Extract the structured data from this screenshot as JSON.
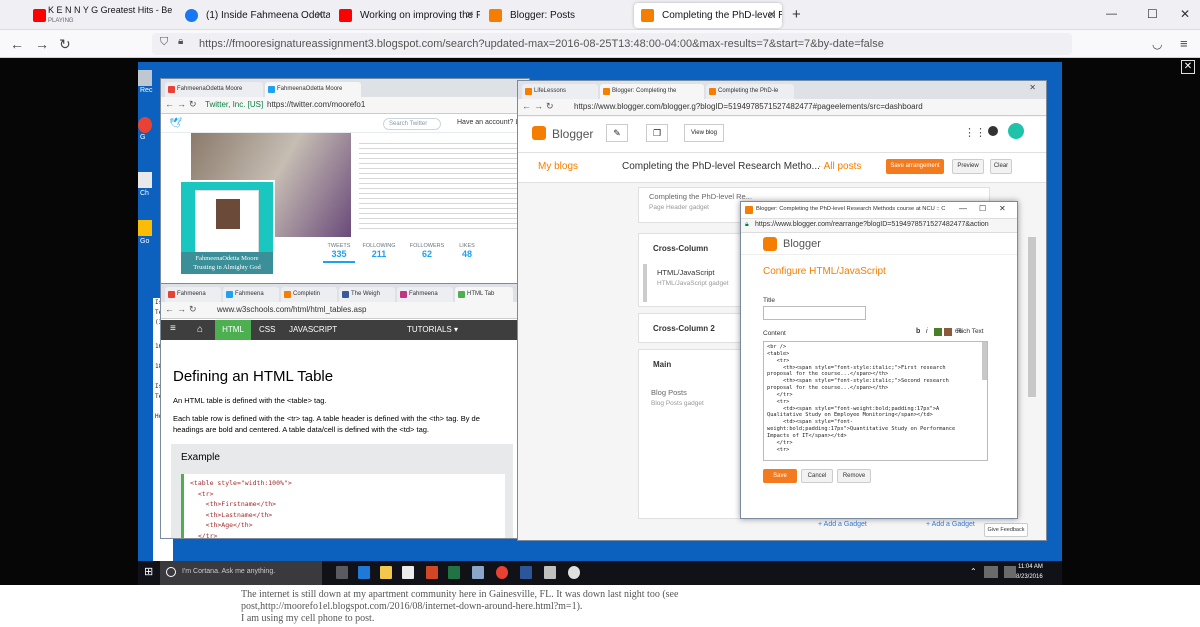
{
  "browser": {
    "tabs": [
      {
        "label": "K E N N Y G Greatest Hits - Be",
        "sublabel": "PLAYING",
        "icon": "youtube-icon",
        "color": "#ff0000"
      },
      {
        "label": "(1) Inside Fahmeena Odetta's H",
        "icon": "facebook-icon",
        "color": "#1877f2"
      },
      {
        "label": "Working on improving the Purp",
        "icon": "youtube-icon",
        "color": "#ff0000"
      },
      {
        "label": "Blogger: Posts",
        "icon": "blogger-icon",
        "color": "#f57d00"
      },
      {
        "label": "Completing the PhD-level Rese",
        "icon": "blogger-icon",
        "color": "#f57d00"
      }
    ],
    "new_tab": "+",
    "url": "https://fmooresignatureassignment3.blogspot.com/search?updated-max=2016-08-25T13:48:00-04:00&max-results=7&start=7&by-date=false",
    "window_controls": {
      "minimize": "—",
      "maximize": "☐",
      "close": "✕"
    },
    "viewer_close": "✕"
  },
  "desktop": {
    "icons": [
      "Rec",
      "G",
      "Go",
      "Ch",
      "Ex",
      "Go",
      "Co"
    ],
    "side_texts": [
      "Is",
      "Te",
      "(3",
      "16",
      "18",
      "Is",
      "Te",
      "Ho"
    ]
  },
  "twitter_window": {
    "tabs": [
      "FahmeenaOdetta Moore",
      "FahmeenaOdetta Moore"
    ],
    "info": "Twitter, Inc. [US]",
    "url": "https://twitter.com/moorefo1",
    "search_placeholder": "Search Twitter",
    "have_account": "Have an account? Log",
    "profile_name": "FahmeenaOdetta Moore",
    "profile_caption": "Trusting in Almighty God",
    "stats": [
      {
        "label": "TWEETS",
        "value": "335"
      },
      {
        "label": "FOLLOWING",
        "value": "211"
      },
      {
        "label": "FOLLOWERS",
        "value": "62"
      },
      {
        "label": "LIKES",
        "value": "48"
      }
    ]
  },
  "w3_window": {
    "tabs": [
      "Fahmeena",
      "Fahmeena",
      "Completin",
      "The Weigh",
      "Fahmeena",
      "HTML Tab"
    ],
    "url": "www.w3schools.com/html/html_tables.asp",
    "nav": [
      "HTML",
      "CSS",
      "JAVASCRIPT",
      "TUTORIALS ▾"
    ],
    "heading": "Defining an HTML Table",
    "p1": "An HTML table is defined with the <table> tag.",
    "p2": "Each table row is defined with the <tr> tag. A table header is defined with the <th> tag. By de",
    "p3": "headings are bold and centered. A table data/cell is defined with the <td> tag.",
    "example_label": "Example",
    "code": [
      "<table style=\"width:100%\">",
      "  <tr>",
      "    <th>Firstname</th>",
      "    <th>Lastname</th>",
      "    <th>Age</th>",
      "  </tr>"
    ]
  },
  "blogger_window": {
    "tabs": [
      "LifeLessons",
      "Blogger: Completing the ",
      "Completing the PhD-le"
    ],
    "url": "https://www.blogger.com/blogger.g?blogID=5194978571527482477#pageelements/src=dashboard",
    "brand": "Blogger",
    "view_blog": "View blog",
    "my_blogs": "My blogs",
    "blog_title": "Completing the PhD-level Research Metho...",
    "all_posts": "All posts",
    "save_arrangement": "Save arrangement",
    "preview": "Preview",
    "clear": "Clear",
    "header_gadget_title": "Completing the PhD-level Re...",
    "header_gadget_sub": "Page Header gadget",
    "cross_column": "Cross-Column",
    "html_js_title": "HTML/JavaScript",
    "html_js_sub": "HTML/JavaScript gadget",
    "cross_column_2": "Cross-Column 2",
    "main": "Main",
    "blog_posts_title": "Blog Posts",
    "blog_posts_sub": "Blog Posts gadget",
    "add_gadget_1": "Add a Gadget",
    "add_gadget_2": "Add a Gadget",
    "give_feedback": "Give Feedback"
  },
  "config_window": {
    "title": "Blogger: Completing the PhD-level Research Methods course at NCU :: C...",
    "url": "https://www.blogger.com/rearrange?blogID=5194978571527482477&action",
    "brand": "Blogger",
    "heading": "Configure HTML/JavaScript",
    "title_label": "Title",
    "content_label": "Content",
    "rich_text": "Rich Text",
    "toolbar": [
      "b",
      "i",
      "66"
    ],
    "code": [
      "<br />",
      "<table>",
      "   <tr>",
      "     <th><span style=\"font-style:italic;\">First research",
      "proposal for the course...</span></th>",
      "     <th><span style=\"font-style:italic;\">Second research",
      "proposal for the course...</span></th>",
      "   </tr>",
      "   <tr>",
      "     <td><span style=\"font-weight:bold;padding:17px\">A",
      "Qualitative Study on Employee Monitoring</span></td>",
      "     <td><span style=\"font-",
      "weight:bold;padding:17px\">Quantitative Study on Performance",
      "Impacts of IT</span></td>",
      "   </tr>",
      "   <tr>"
    ],
    "save": "Save",
    "cancel": "Cancel",
    "remove": "Remove"
  },
  "taskbar": {
    "cortana": "I'm Cortana. Ask me anything.",
    "time": "11:04 AM",
    "date": "8/23/2016"
  },
  "blog_text": [
    "The internet is still down at my apartment community here in Gainesville, FL. It was down last night too (see",
    "post,http://moorefo1el.blogspot.com/2016/08/internet-down-around-here.html?m=1).",
    "I am using my cell phone to post."
  ]
}
